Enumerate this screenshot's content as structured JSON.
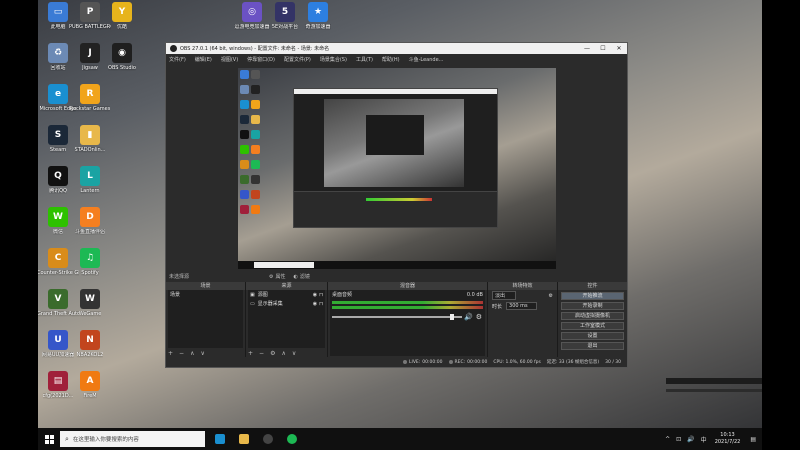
{
  "desktop": {
    "left_icons": [
      {
        "label": "此电脑",
        "icon": "computer-icon",
        "color": "#3a7bd5",
        "glyph": "▭"
      },
      {
        "label": "PUBG BATTLEGROUNDS",
        "icon": "pubg-icon",
        "color": "#555555",
        "glyph": "P"
      },
      {
        "label": "回收站",
        "icon": "recycle-bin-icon",
        "color": "#6c8ab5",
        "glyph": "♻"
      },
      {
        "label": "Jigsaw",
        "icon": "jigsaw-icon",
        "color": "#222222",
        "glyph": "J"
      },
      {
        "label": "Microsoft Edge",
        "icon": "edge-icon",
        "color": "#1a8fd0",
        "glyph": "e"
      },
      {
        "label": "Rockstar Games",
        "icon": "rockstar-icon",
        "color": "#f1a41b",
        "glyph": "R"
      },
      {
        "label": "Steam",
        "icon": "steam-icon",
        "color": "#1b2838",
        "glyph": "S"
      },
      {
        "label": "STADOnlin...",
        "icon": "folder-icon",
        "color": "#e8b84a",
        "glyph": "▮"
      },
      {
        "label": "腾讯QQ",
        "icon": "qq-icon",
        "color": "#111111",
        "glyph": "Q"
      },
      {
        "label": "Lantern",
        "icon": "lantern-icon",
        "color": "#1aa3a3",
        "glyph": "L"
      },
      {
        "label": "微信",
        "icon": "wechat-icon",
        "color": "#2dc100",
        "glyph": "W"
      },
      {
        "label": "斗鱼直播伴侣",
        "icon": "douyu-icon",
        "color": "#f57f20",
        "glyph": "D"
      },
      {
        "label": "Counter-Strike Global Off...",
        "icon": "csgo-icon",
        "color": "#d98c1a",
        "glyph": "C"
      },
      {
        "label": "Spotify",
        "icon": "spotify-icon",
        "color": "#1db954",
        "glyph": "♫"
      },
      {
        "label": "Grand Theft Auto V",
        "icon": "gta-icon",
        "color": "#3a6b2c",
        "glyph": "V"
      },
      {
        "label": "WeGame",
        "icon": "wegame-icon",
        "color": "#333333",
        "glyph": "W"
      },
      {
        "label": "网易UU加速器",
        "icon": "uu-icon",
        "color": "#3556c9",
        "glyph": "U"
      },
      {
        "label": "NBA2KOL2",
        "icon": "nba-icon",
        "color": "#c2451e",
        "glyph": "N"
      },
      {
        "label": "cfg(2021D...",
        "icon": "archive-icon",
        "color": "#a0203a",
        "glyph": "▤"
      },
      {
        "label": "FireM",
        "icon": "firem-icon",
        "color": "#f07a12",
        "glyph": "A"
      }
    ],
    "top_row_icons": [
      {
        "label": "优酷",
        "icon": "youku-icon",
        "color": "#e7b41c",
        "glyph": "Y"
      },
      {
        "label": "OBS Studio",
        "icon": "obs-icon",
        "color": "#1f1f1f",
        "glyph": "◉"
      }
    ],
    "top_icons": [
      {
        "label": "逗游电竞加速器",
        "icon": "douyou-icon",
        "color": "#6b52c4",
        "glyph": "◎"
      },
      {
        "label": "5E对战平台",
        "icon": "5e-icon",
        "color": "#333366",
        "glyph": "5"
      },
      {
        "label": "奇游加速器",
        "icon": "qiyou-icon",
        "color": "#2d7fe0",
        "glyph": "★"
      }
    ]
  },
  "obs": {
    "title": "OBS 27.0.1 (64 bit, windows) - 配置文件: 未命名 - 场景: 未命名",
    "window_controls": [
      "—",
      "☐",
      "✕"
    ],
    "menu": [
      "文件(F)",
      "编辑(E)",
      "视图(V)",
      "停靠窗口(D)",
      "配置文件(P)",
      "场景集合(S)",
      "工具(T)",
      "帮助(H)",
      "斗鱼-Leande..."
    ],
    "scene_toolbar": {
      "label": "未选择源",
      "properties": "属性",
      "filters": "滤镜"
    },
    "docks": {
      "scenes": {
        "header": "场景",
        "items": [
          "场景"
        ],
        "footer": [
          "+",
          "−",
          "∧",
          "∨"
        ]
      },
      "sources": {
        "header": "来源",
        "items": [
          "源图",
          "显示器采集"
        ],
        "footer": [
          "+",
          "−",
          "⚙",
          "∧",
          "∨"
        ]
      },
      "mixer": {
        "header": "混音器",
        "track_name": "桌面音频",
        "db_value": "0.0 dB"
      },
      "transitions": {
        "header": "转场特效",
        "type": "淡出",
        "duration_label": "时长",
        "duration_value": "300 ms"
      },
      "controls": {
        "header": "控件",
        "buttons": [
          "开始推流",
          "开始录制",
          "启动虚拟摄像机",
          "工作室模式",
          "设置",
          "退出"
        ]
      }
    },
    "status": {
      "live_label": "LIVE:",
      "live_time": "00:00:00",
      "rec_label": "REC:",
      "rec_time": "00:00:00",
      "cpu": "CPU: 1.0%, 60.00 fps",
      "extra": "延迟: 33 (36 帧组合信息)",
      "fps": "30 / 30"
    }
  },
  "taskbar": {
    "search_placeholder": "在这里输入你要搜索的内容",
    "apps": [
      {
        "icon": "edge-icon",
        "color": "#1a8fd0"
      },
      {
        "icon": "file-explorer-icon",
        "color": "#e8b84a"
      },
      {
        "icon": "obs-icon",
        "color": "#444444"
      },
      {
        "icon": "spotify-icon",
        "color": "#1db954"
      }
    ],
    "tray_icons": [
      "^",
      "⊡",
      "🔊",
      "中"
    ],
    "time": "10:13",
    "date": "2021/7/22",
    "notification": "▤"
  }
}
